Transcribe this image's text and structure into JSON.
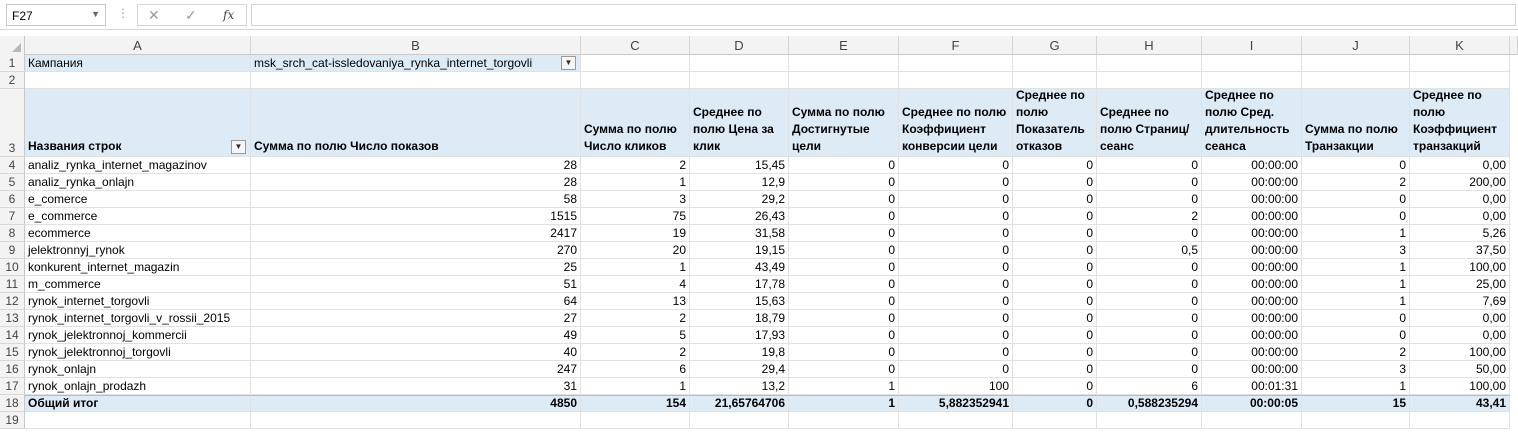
{
  "formula_bar": {
    "name_box": "F27",
    "formula": "",
    "fx_label": "fx",
    "cancel_icon": "✕",
    "enter_icon": "✓"
  },
  "columns": [
    "A",
    "B",
    "C",
    "D",
    "E",
    "F",
    "G",
    "H",
    "I",
    "J",
    "K"
  ],
  "row_numbers": [
    "1",
    "2",
    "3",
    "4",
    "5",
    "6",
    "7",
    "8",
    "9",
    "10",
    "11",
    "12",
    "13",
    "14",
    "15",
    "16",
    "17",
    "18",
    "19"
  ],
  "filter": {
    "label": "Кампания",
    "value": "msk_srch_cat-issledovaniya_rynka_internet_torgovli"
  },
  "headers": [
    "Названия строк",
    "Сумма по полю Число показов",
    "Сумма по полю Число кликов",
    "Среднее по полю Цена за клик",
    "Сумма по полю Достигнутые цели",
    "Среднее по полю Коэффициент конверсии цели",
    "Среднее по полю Показатель отказов",
    "Среднее по полю Страниц/сеанс",
    "Среднее по полю Сред. длительность сеанса",
    "Сумма по полю Транзакции",
    "Среднее по полю Коэффициент транзакций"
  ],
  "rows": [
    [
      "analiz_rynka_internet_magazinov",
      "28",
      "2",
      "15,45",
      "0",
      "0",
      "0",
      "0",
      "00:00:00",
      "0",
      "0,00"
    ],
    [
      "analiz_rynka_onlajn",
      "28",
      "1",
      "12,9",
      "0",
      "0",
      "0",
      "0",
      "00:00:00",
      "2",
      "200,00"
    ],
    [
      "e_comerce",
      "58",
      "3",
      "29,2",
      "0",
      "0",
      "0",
      "0",
      "00:00:00",
      "0",
      "0,00"
    ],
    [
      "e_commerce",
      "1515",
      "75",
      "26,43",
      "0",
      "0",
      "0",
      "2",
      "00:00:00",
      "0",
      "0,00"
    ],
    [
      "ecommerce",
      "2417",
      "19",
      "31,58",
      "0",
      "0",
      "0",
      "0",
      "00:00:00",
      "1",
      "5,26"
    ],
    [
      "jelektronnyj_rynok",
      "270",
      "20",
      "19,15",
      "0",
      "0",
      "0",
      "0,5",
      "00:00:00",
      "3",
      "37,50"
    ],
    [
      "konkurent_internet_magazin",
      "25",
      "1",
      "43,49",
      "0",
      "0",
      "0",
      "0",
      "00:00:00",
      "1",
      "100,00"
    ],
    [
      "m_commerce",
      "51",
      "4",
      "17,78",
      "0",
      "0",
      "0",
      "0",
      "00:00:00",
      "1",
      "25,00"
    ],
    [
      "rynok_internet_torgovli",
      "64",
      "13",
      "15,63",
      "0",
      "0",
      "0",
      "0",
      "00:00:00",
      "1",
      "7,69"
    ],
    [
      "rynok_internet_torgovli_v_rossii_2015",
      "27",
      "2",
      "18,79",
      "0",
      "0",
      "0",
      "0",
      "00:00:00",
      "0",
      "0,00"
    ],
    [
      "rynok_jelektronnoj_kommercii",
      "49",
      "5",
      "17,93",
      "0",
      "0",
      "0",
      "0",
      "00:00:00",
      "0",
      "0,00"
    ],
    [
      "rynok_jelektronnoj_torgovli",
      "40",
      "2",
      "19,8",
      "0",
      "0",
      "0",
      "0",
      "00:00:00",
      "2",
      "100,00"
    ],
    [
      "rynok_onlajn",
      "247",
      "6",
      "29,4",
      "0",
      "0",
      "0",
      "0",
      "00:00:00",
      "3",
      "50,00"
    ],
    [
      "rynok_onlajn_prodazh",
      "31",
      "1",
      "13,2",
      "1",
      "100",
      "0",
      "6",
      "00:01:31",
      "1",
      "100,00"
    ]
  ],
  "total": [
    "Общий итог",
    "4850",
    "154",
    "21,65764706",
    "1",
    "5,882352941",
    "0",
    "0,588235294",
    "00:00:05",
    "15",
    "43,41"
  ]
}
